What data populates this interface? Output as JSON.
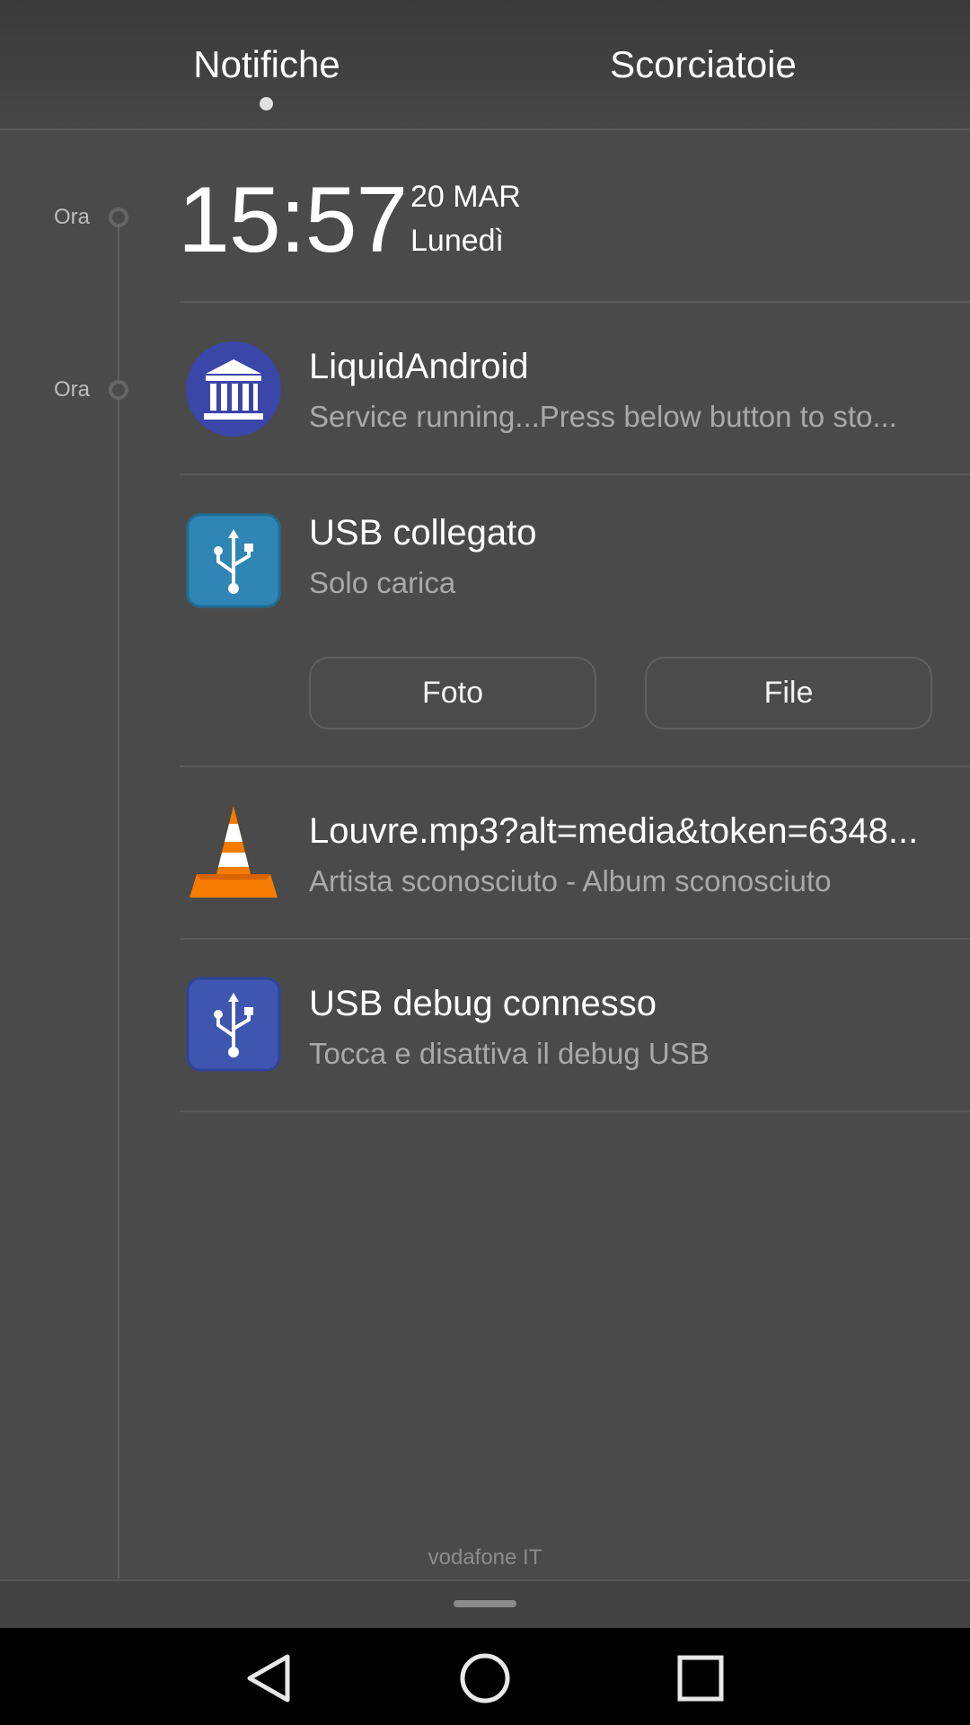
{
  "tabs": {
    "notifications": "Notifiche",
    "shortcuts": "Scorciatoie"
  },
  "timeline": {
    "clock_label": "Ora",
    "first_notif_label": "Ora"
  },
  "clock": {
    "time": "15:57",
    "date": "20 MAR",
    "day": "Lunedì"
  },
  "notifications": [
    {
      "icon": "museum-icon",
      "title": "LiquidAndroid",
      "text": "Service running...Press below button to sto..."
    },
    {
      "icon": "usb-icon",
      "title": "USB collegato",
      "text": "Solo carica",
      "actions": [
        "Foto",
        "File"
      ]
    },
    {
      "icon": "vlc-cone-icon",
      "title": "Louvre.mp3?alt=media&token=6348...",
      "text": "Artista sconosciuto - Album sconosciuto"
    },
    {
      "icon": "usb-debug-icon",
      "title": "USB debug connesso",
      "text": "Tocca e disattiva il debug USB"
    }
  ],
  "carrier": "vodafone IT",
  "colors": {
    "background": "#4a4a4a",
    "museum_icon": "#3a46a8",
    "usb_icon": "#2f86b4",
    "usb_debug_icon": "#3f56b0",
    "vlc_orange": "#f57c00"
  },
  "navbar": {
    "back": "back-icon",
    "home": "home-icon",
    "recents": "recents-icon"
  }
}
